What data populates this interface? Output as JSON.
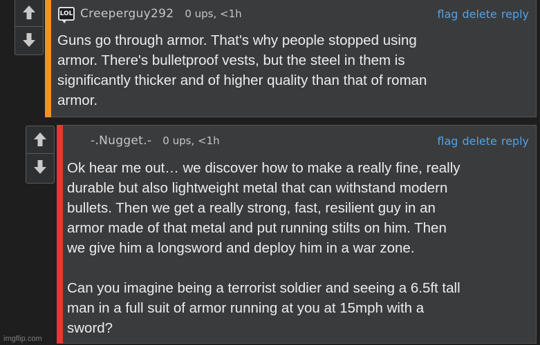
{
  "colors": {
    "background": "#1e1e1e",
    "comment_background": "#3a3b3d",
    "link_blue": "#4fa3ea",
    "comment1_accent": "#f2921f",
    "comment2_accent": "#e8372f"
  },
  "comments": [
    {
      "avatar_text": "LOL",
      "username": "Creeperguy292",
      "stats": "0 ups, <1h",
      "actions": [
        "flag",
        "delete",
        "reply"
      ],
      "body": "Guns go through armor. That's why people stopped using\narmor. There's bulletproof vests, but the steel in them is\nsignificantly thicker and of higher quality than that of roman\narmor."
    },
    {
      "username": "-.Nugget.-",
      "stats": "0 ups, <1h",
      "actions": [
        "flag",
        "delete",
        "reply"
      ],
      "body": "Ok hear me out… we discover how to make a really fine, really\ndurable but also lightweight metal that can withstand modern\nbullets. Then we get a really strong, fast, resilient guy in an\narmor made of that metal and put running stilts on him. Then\nwe give him a longsword and deploy him in a war zone.\n\nCan you imagine being a terrorist soldier and seeing a 6.5ft tall\nman in a full suit of armor running at you at 15mph with a\nsword?"
    }
  ],
  "watermark": "imgflip.com"
}
